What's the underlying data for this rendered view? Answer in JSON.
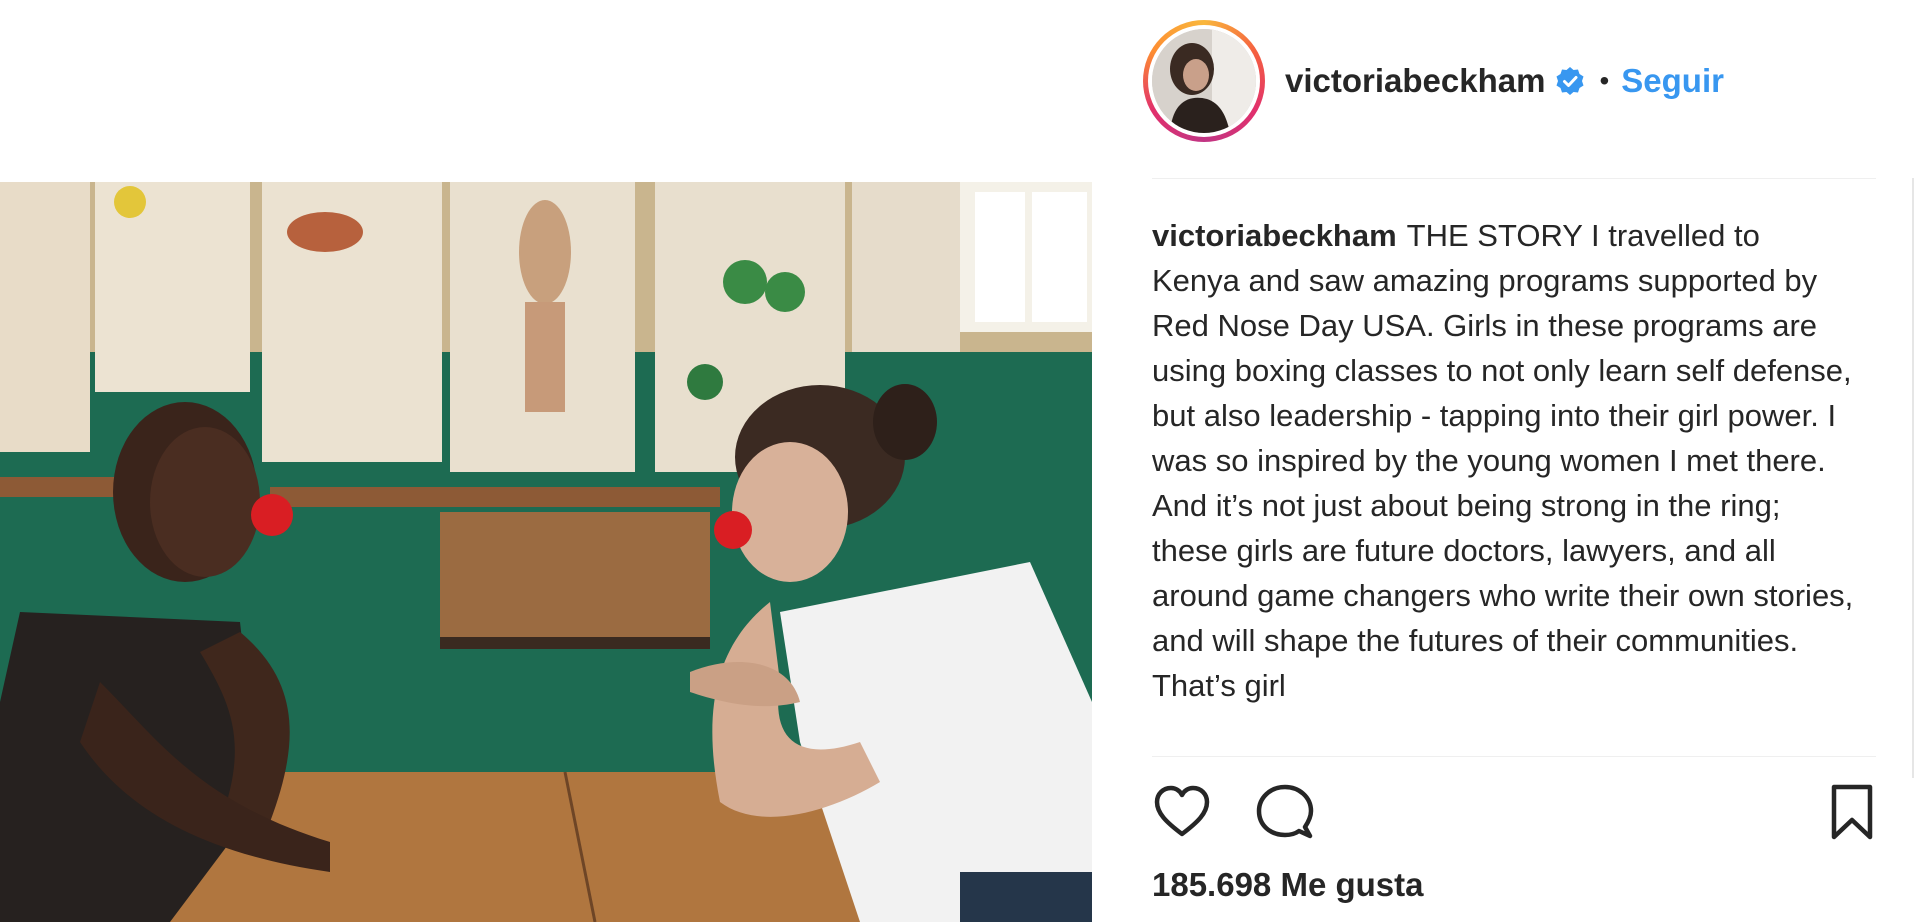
{
  "post": {
    "username": "victoriabeckham",
    "verified_icon": "verified-badge-icon",
    "separator": "•",
    "follow_label": "Seguir",
    "caption_username": "victoriabeckham",
    "caption_text": "THE STORY I travelled to Kenya and saw amazing programs supported by Red Nose Day USA. Girls in these programs are using boxing classes to not only learn self defense, but also leadership - tapping into their girl power. I was so inspired by the young women I met there. And it’s not just about being strong in the ring; these girls are future doctors, lawyers, and all around game changers who write their own stories, and will shape the futures of their communities. That’s girl",
    "likes": "185.698 Me gusta"
  },
  "icons": {
    "like": "heart-icon",
    "comment": "comment-bubble-icon",
    "save": "bookmark-icon"
  },
  "colors": {
    "link": "#3897f0",
    "verified": "#3897f0",
    "text": "#262626",
    "divider": "#efefef"
  }
}
